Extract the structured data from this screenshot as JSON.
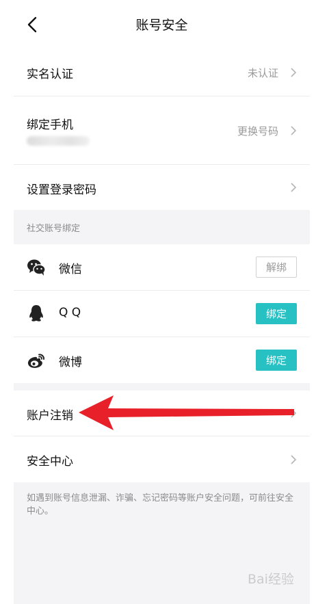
{
  "header": {
    "title": "账号安全",
    "back_icon": "chevron-left-icon"
  },
  "rows": {
    "realname": {
      "label": "实名认证",
      "value": "未认证"
    },
    "phone": {
      "label": "绑定手机",
      "value": "更换号码"
    },
    "password": {
      "label": "设置登录密码"
    }
  },
  "social": {
    "section_title": "社交账号绑定",
    "items": [
      {
        "icon": "wechat-icon",
        "label": "微信",
        "action": "解绑"
      },
      {
        "icon": "qq-icon",
        "label": "Q Q",
        "action": "绑定"
      },
      {
        "icon": "weibo-icon",
        "label": "微博",
        "action": "绑定"
      }
    ]
  },
  "account": {
    "cancel_label": "账户注销",
    "security_center_label": "安全中心"
  },
  "footnote": "如遇到账号信息泄漏、诈骗、忘记密码等账户安全问题，可前往安全中心。",
  "watermark": "Bai经验",
  "colors": {
    "accent": "#27c1c4",
    "arrow": "#e8202a",
    "background": "#f4f4f6"
  }
}
